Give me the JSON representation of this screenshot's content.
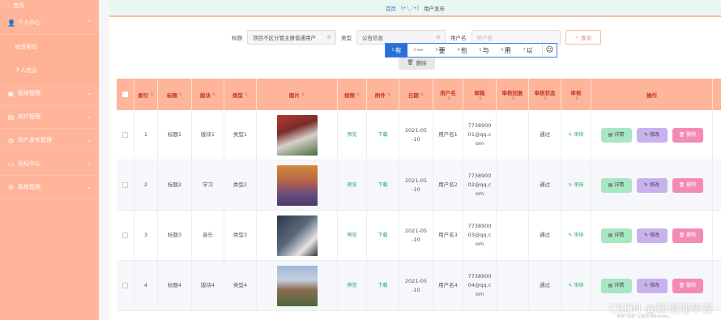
{
  "sidebar": {
    "top_label": "首页",
    "items": [
      {
        "label": "个人中心",
        "icon": "user-icon"
      },
      {
        "label": "修改密码",
        "sub": true
      },
      {
        "label": "个人信息",
        "sub": true
      },
      {
        "label": "板块管理",
        "icon": "box-icon"
      },
      {
        "label": "用户管理",
        "icon": "users-icon"
      },
      {
        "label": "用户发布管理",
        "icon": "globe-icon"
      },
      {
        "label": "论坛中心",
        "icon": "chat-icon"
      },
      {
        "label": "系统管理",
        "icon": "gear-icon"
      }
    ]
  },
  "breadcrumb": {
    "home": "首页",
    "face": "(•'◡'•)",
    "current": "用户发布"
  },
  "search": {
    "title_label": "标题",
    "title_value": "项目不区分管主册普通用户",
    "type_label": "类型",
    "type_value": "公告信息",
    "username_label": "用户名",
    "username_placeholder": "用户名",
    "query_button": "查询",
    "delete_button": "删除"
  },
  "ime": {
    "candidates": [
      {
        "num": "1",
        "text": "有"
      },
      {
        "num": "2",
        "text": "一"
      },
      {
        "num": "3",
        "text": "要"
      },
      {
        "num": "4",
        "text": "也"
      },
      {
        "num": "5",
        "text": "与"
      },
      {
        "num": "6",
        "text": "用"
      },
      {
        "num": "7",
        "text": "以"
      }
    ],
    "emoji": "☺"
  },
  "table": {
    "headers": [
      "索引",
      "标题",
      "版块",
      "类型",
      "图片",
      "视频",
      "附件",
      "日期",
      "用户名",
      "邮箱",
      "审核回复",
      "审核状态",
      "审核",
      "操作"
    ],
    "rows": [
      {
        "index": "1",
        "title": "标题1",
        "block": "版块1",
        "type": "类型1",
        "video": "预览",
        "attach": "下载",
        "date1": "2021-05",
        "date2": "-10",
        "user": "用户名1",
        "mail1": "7738900",
        "mail2": "01@qq.c",
        "mail3": "om",
        "reply": "",
        "status": "通过",
        "audit": "审核"
      },
      {
        "index": "2",
        "title": "标题2",
        "block": "学习",
        "type": "类型2",
        "video": "预览",
        "attach": "下载",
        "date1": "2021-05",
        "date2": "-10",
        "user": "用户名2",
        "mail1": "7738900",
        "mail2": "02@qq.c",
        "mail3": "om",
        "reply": "",
        "status": "通过",
        "audit": "审核"
      },
      {
        "index": "3",
        "title": "标题3",
        "block": "音乐",
        "type": "类型3",
        "video": "预览",
        "attach": "下载",
        "date1": "2021-05",
        "date2": "-10",
        "user": "用户名3",
        "mail1": "7738900",
        "mail2": "03@qq.c",
        "mail3": "om",
        "reply": "",
        "status": "通过",
        "audit": "审核"
      },
      {
        "index": "4",
        "title": "标题4",
        "block": "版块4",
        "type": "类型4",
        "video": "预览",
        "attach": "下载",
        "date1": "2021-05",
        "date2": "-10",
        "user": "用户名4",
        "mail1": "7738900",
        "mail2": "04@qq.c",
        "mail3": "om",
        "reply": "",
        "status": "通过",
        "audit": "审核"
      }
    ],
    "ops": {
      "detail": "详情",
      "edit": "修改",
      "delete": "删除"
    }
  },
  "watermark": "CSDN @粉泡泡毕设",
  "activation_hint": "转到\"设置\"以激活 Windows。",
  "colors": {
    "sidebar": "#ffb59a",
    "header": "#ffb59a",
    "accent_link": "#2e7cc9",
    "detail": "#a9e6c3",
    "edit": "#c8b2ee",
    "delete": "#f38bb3"
  }
}
